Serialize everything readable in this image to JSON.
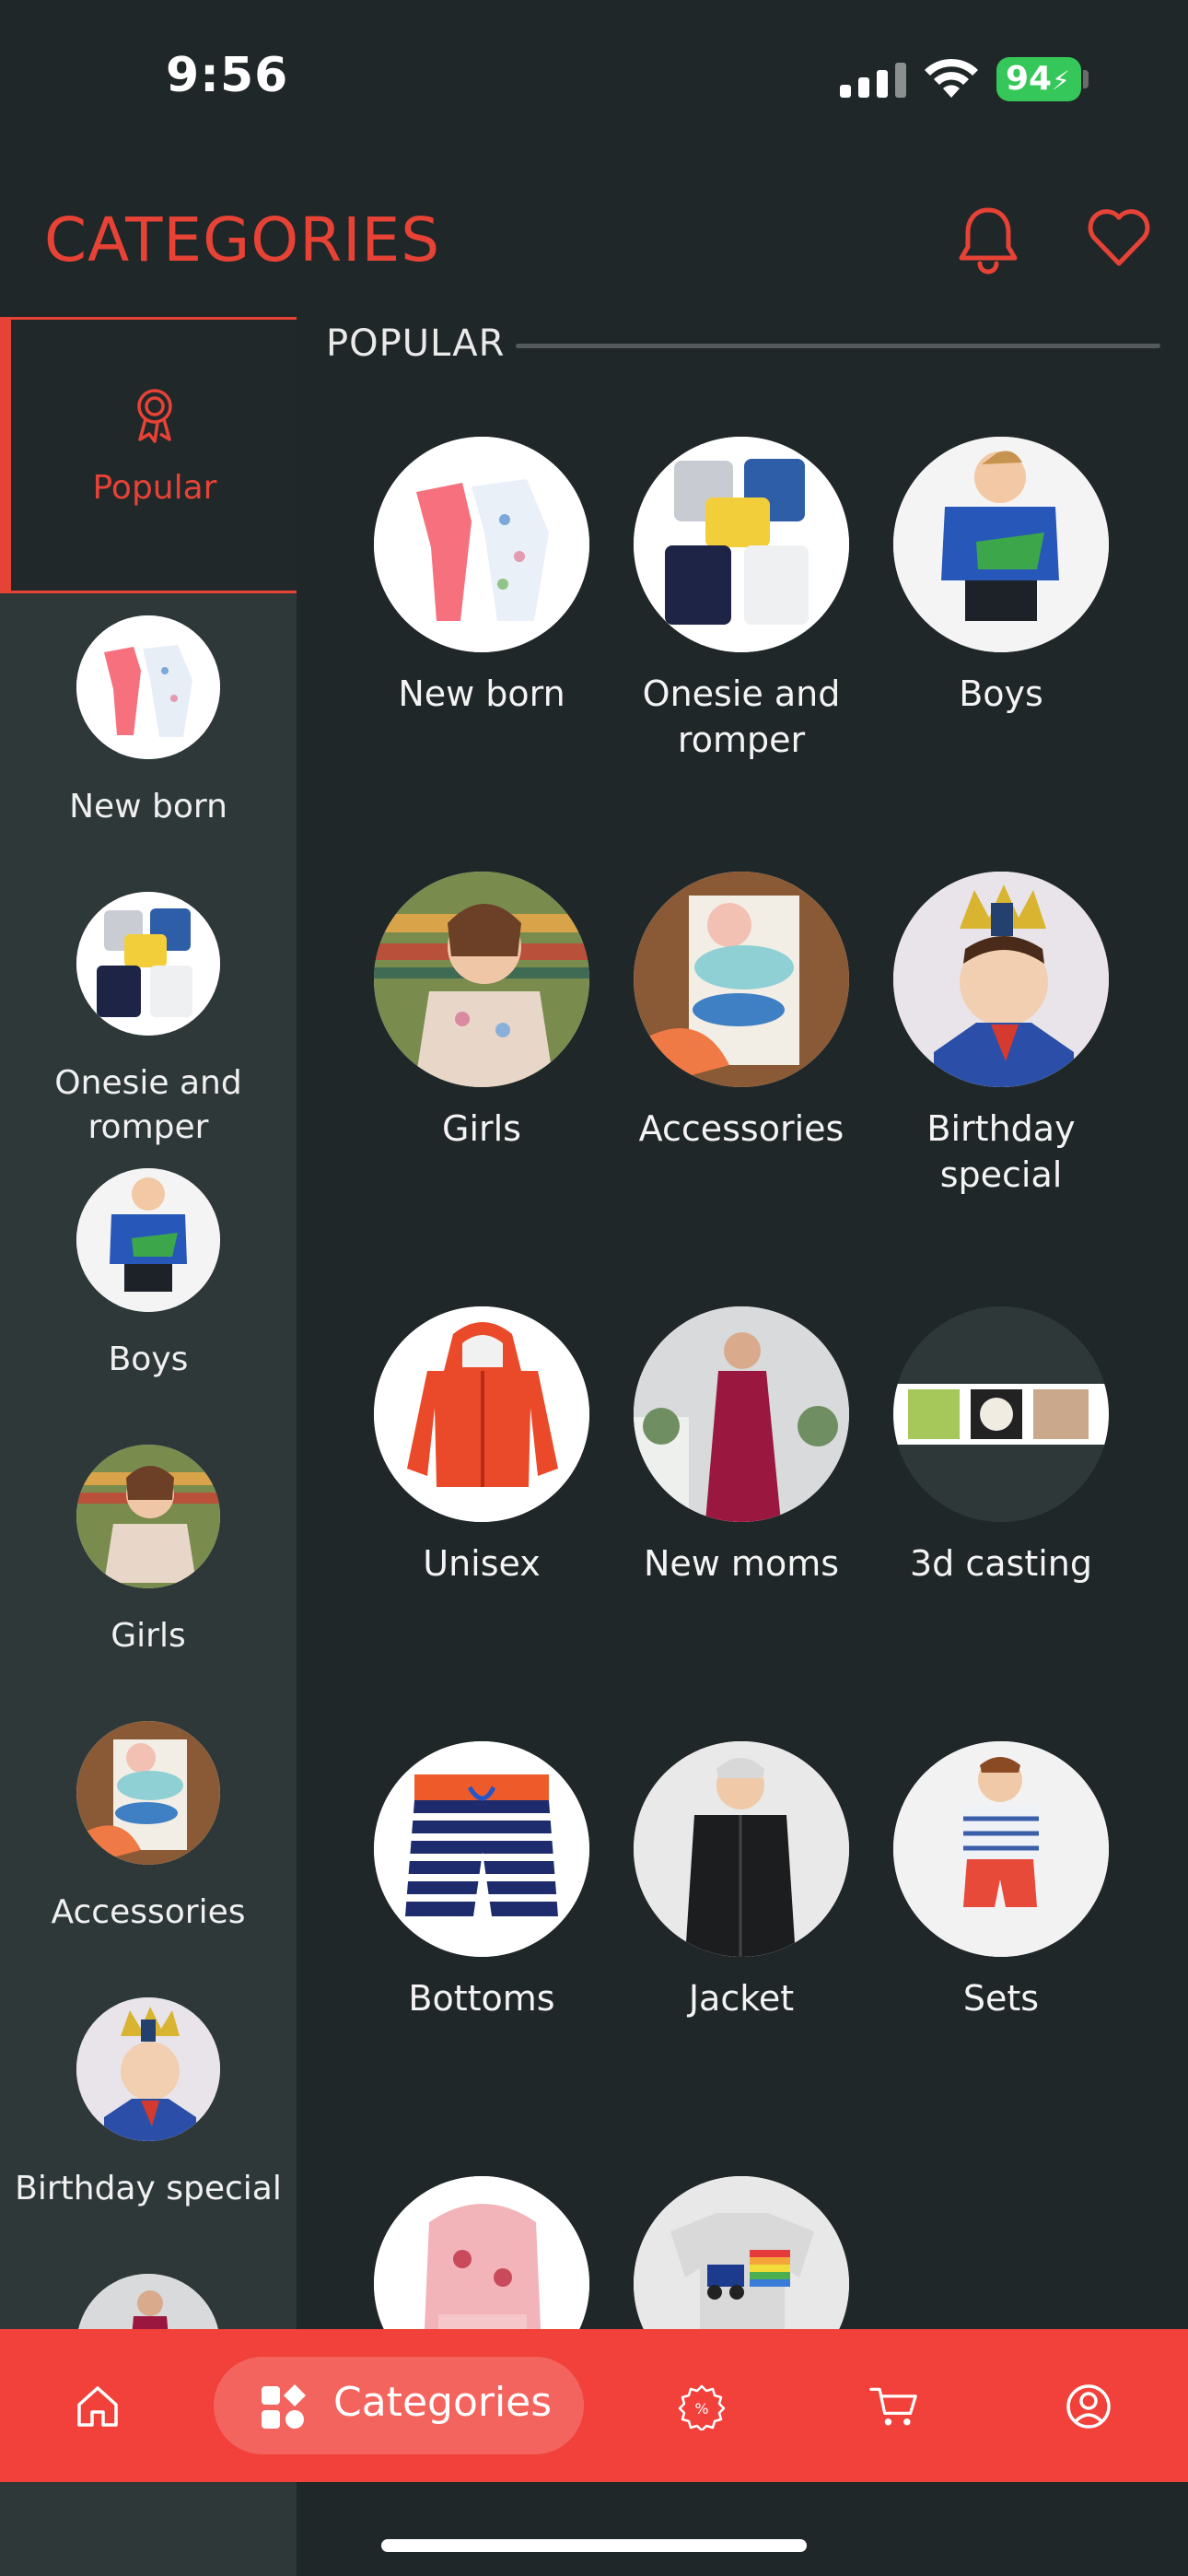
{
  "status": {
    "time": "9:56",
    "battery": "94"
  },
  "header": {
    "title": "CATEGORIES"
  },
  "sidebar": {
    "active_label": "Popular",
    "items": [
      {
        "label": "New born"
      },
      {
        "label": "Onesie and romper"
      },
      {
        "label": "Boys"
      },
      {
        "label": "Girls"
      },
      {
        "label": "Accessories"
      },
      {
        "label": "Birthday special"
      }
    ]
  },
  "main": {
    "section_title": "POPULAR",
    "categories": [
      {
        "label": "New born"
      },
      {
        "label": "Onesie and romper"
      },
      {
        "label": "Boys"
      },
      {
        "label": "Girls"
      },
      {
        "label": "Accessories"
      },
      {
        "label": "Birthday special"
      },
      {
        "label": "Unisex"
      },
      {
        "label": "New moms"
      },
      {
        "label": "3d casting"
      },
      {
        "label": "Bottoms"
      },
      {
        "label": "Jacket"
      },
      {
        "label": "Sets"
      },
      {
        "label": ""
      },
      {
        "label": ""
      }
    ]
  },
  "bottom_nav": {
    "active_label": "Categories"
  },
  "colors": {
    "accent": "#e74236",
    "background": "#202728",
    "sidebar": "#2e3839"
  }
}
